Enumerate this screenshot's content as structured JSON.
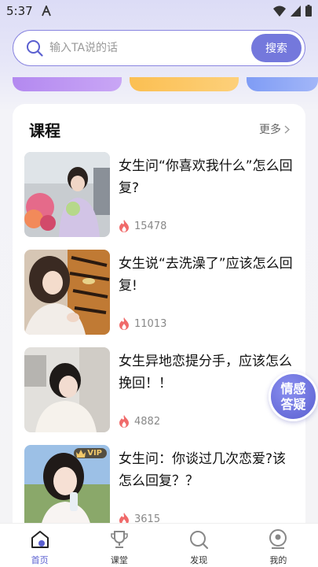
{
  "status_bar": {
    "time": "5:37"
  },
  "search": {
    "placeholder": "输入TA说的话",
    "button_label": "搜索"
  },
  "courses": {
    "title": "课程",
    "more_label": "更多",
    "items": [
      {
        "title": "女生问“你喜欢我什么”怎么回复?",
        "views": "15478",
        "vip": false
      },
      {
        "title": "女生说“去洗澡了”应该怎么回复!",
        "views": "11013",
        "vip": false
      },
      {
        "title": "女生异地恋提分手，应该怎么挽回！！",
        "views": "4882",
        "vip": false
      },
      {
        "title": "女生问：你谈过几次恋爱?该怎么回复？？",
        "views": "3615",
        "vip": true,
        "vip_label": "VIP"
      }
    ]
  },
  "float_badge": {
    "line1": "情感",
    "line2": "答疑"
  },
  "bottom_nav": {
    "items": [
      {
        "label": "首页",
        "icon": "home-icon",
        "active": true
      },
      {
        "label": "课堂",
        "icon": "trophy-icon",
        "active": false
      },
      {
        "label": "发现",
        "icon": "discover-icon",
        "active": false
      },
      {
        "label": "我的",
        "icon": "profile-icon",
        "active": false
      }
    ]
  },
  "colors": {
    "accent": "#7478dc",
    "fire": "#f06a6a"
  }
}
